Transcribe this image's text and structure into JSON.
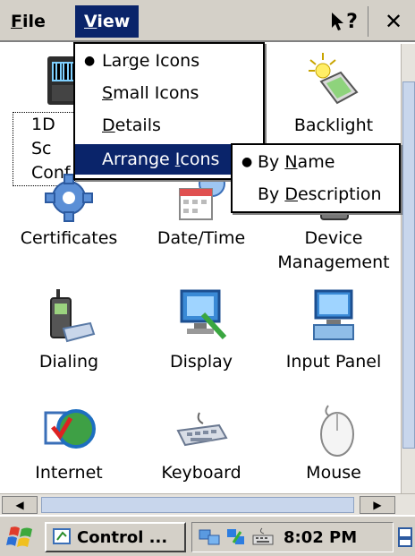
{
  "menubar": {
    "file": {
      "pre": "",
      "ul": "F",
      "post": "ile"
    },
    "view": {
      "pre": "",
      "ul": "V",
      "post": "iew"
    },
    "help": "?",
    "close": "✕"
  },
  "view_menu": {
    "items": [
      {
        "pre": "Lar",
        "ul": "g",
        "post": "e Icons",
        "checked": true
      },
      {
        "pre": "",
        "ul": "S",
        "post": "mall Icons",
        "checked": false
      },
      {
        "pre": "",
        "ul": "D",
        "post": "etails",
        "checked": false
      },
      {
        "pre": "Arrange ",
        "ul": "I",
        "post": "cons",
        "checked": false,
        "selected": true
      }
    ]
  },
  "arrange_submenu": {
    "items": [
      {
        "pre": "By ",
        "ul": "N",
        "post": "ame",
        "checked": true
      },
      {
        "pre": "By ",
        "ul": "D",
        "post": "escription",
        "checked": false
      }
    ]
  },
  "icons": [
    {
      "label": "1D Scanner Config",
      "line1": "1D Sc",
      "line2": "Conf"
    },
    {
      "label": "Backlight"
    },
    {
      "label": "Certificates"
    },
    {
      "label": "Date/Time"
    },
    {
      "label": "Device Management",
      "line1": "Device",
      "line2": "Management"
    },
    {
      "label": "Dialing"
    },
    {
      "label": "Display"
    },
    {
      "label": "Input Panel"
    },
    {
      "label": "Internet"
    },
    {
      "label": "Keyboard"
    },
    {
      "label": "Mouse"
    }
  ],
  "taskbar": {
    "task_label": "Control ...",
    "time": "8:02 PM"
  }
}
